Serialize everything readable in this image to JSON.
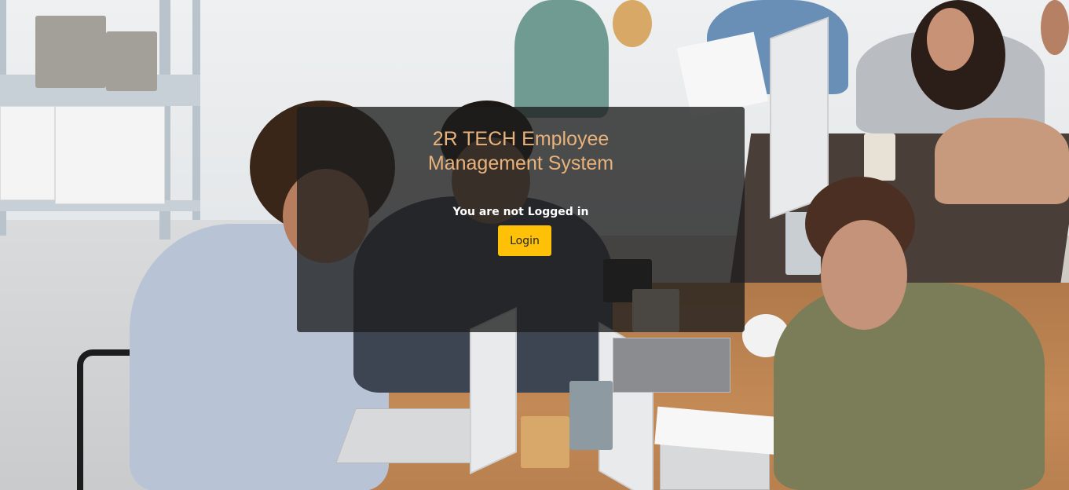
{
  "page": {
    "title": "2R TECH Employee\nManagement System",
    "status_text": "You are not Logged in",
    "login_label": "Login"
  },
  "colors": {
    "title": "#e8b27a",
    "button_bg": "#ffc107",
    "button_text": "#212529",
    "panel_bg": "rgba(30,30,30,0.78)"
  },
  "background": {
    "image": "office-team-photo"
  }
}
